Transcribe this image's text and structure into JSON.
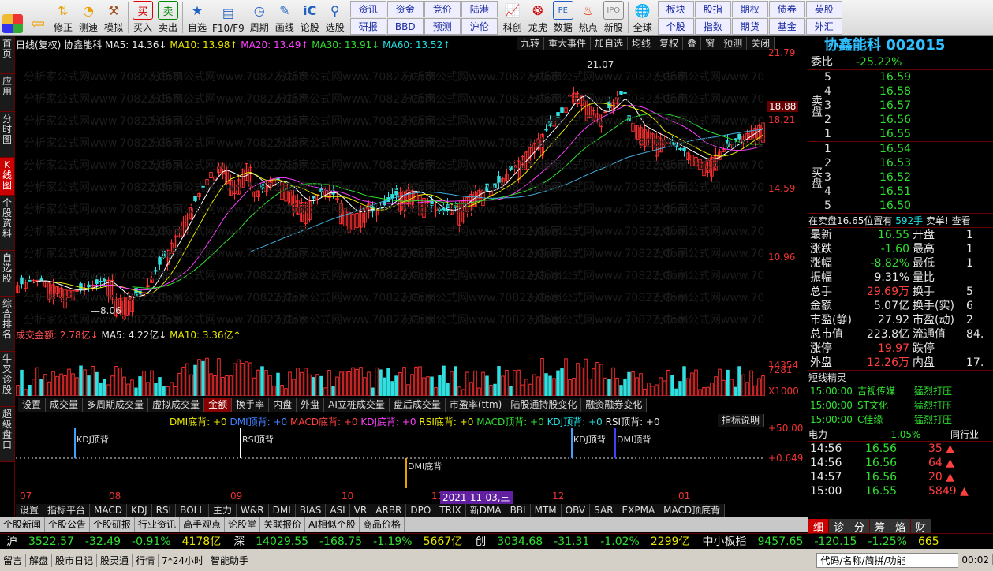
{
  "toolbar": {
    "items": [
      {
        "label": "修正",
        "icon": "arrow-left-icon"
      },
      {
        "label": "测速",
        "icon": "clock-icon"
      },
      {
        "label": "模拟",
        "icon": "hammer-icon"
      },
      {
        "label": "买入",
        "icon": "buy-icon"
      },
      {
        "label": "卖出",
        "icon": "sell-icon"
      },
      {
        "label": "自选",
        "icon": "star-icon"
      },
      {
        "label": "F10/F9",
        "icon": "f10-icon"
      },
      {
        "label": "周期",
        "icon": "period-icon"
      },
      {
        "label": "画线",
        "icon": "pencil-icon"
      },
      {
        "label": "论股",
        "icon": "chat-icon"
      },
      {
        "label": "选股",
        "icon": "magnify-icon"
      }
    ],
    "grid": [
      "资讯",
      "资金",
      "竞价",
      "陆港",
      "研报",
      "BBD",
      "预测",
      "沪伦"
    ],
    "right_items": [
      {
        "label": "科创",
        "icon": "chart-icon"
      },
      {
        "label": "龙虎",
        "icon": "dragon-icon"
      },
      {
        "label": "数据",
        "icon": "pe-icon"
      },
      {
        "label": "热点",
        "icon": "hot-icon"
      },
      {
        "label": "新股",
        "icon": "ipo-icon"
      },
      {
        "label": "全球",
        "icon": "globe-icon"
      }
    ],
    "grid2": [
      "板块",
      "股指",
      "期权",
      "债券",
      "英股",
      "个股",
      "指数",
      "期货",
      "基金",
      "外汇"
    ]
  },
  "left_tabs": [
    "首页",
    "应用",
    "分时图",
    "K线图",
    "个股资料",
    "自选股",
    "综合排名",
    "牛叉诊股",
    "超级盘口"
  ],
  "header": {
    "period": "日线(复权)",
    "name": "协鑫能科",
    "ma5": "MA5: 14.36↓",
    "ma10": "MA10: 13.98↑",
    "ma20": "MA20: 13.49↑",
    "ma30": "MA30: 13.91↓",
    "ma60": "MA60: 13.52↑",
    "buttons": [
      "九转",
      "重大事件",
      "加自选",
      "均线",
      "复权",
      "叠",
      "窗",
      "预测",
      "关闭"
    ]
  },
  "price_labels": [
    "21.79",
    "18.21",
    "14.59",
    "10.96"
  ],
  "current_price_tag": "18.88",
  "high_label": "21.07",
  "low_label": "8.06",
  "watermark": "分析家公式网www.70822.Com",
  "volume": {
    "label": "成交金额: 2.78亿↓",
    "ma5": "MA5: 4.22亿↓",
    "ma10": "MA10: 3.36亿↑",
    "ticks": [
      "14354",
      "7281",
      "X1000"
    ]
  },
  "sub_tabs": [
    "设置",
    "成交量",
    "多周期成交量",
    "虚拟成交量",
    "金额",
    "换手率",
    "内盘",
    "外盘",
    "AI立桩成交量",
    "盘后成交量",
    "市盈率(ttm)",
    "陆股通持股变化",
    "融资融券变化"
  ],
  "indicator": {
    "line": [
      {
        "t": "DMI底背: +0",
        "c": "yel"
      },
      {
        "t": "DMI顶背: +0",
        "c": "blu"
      },
      {
        "t": "MACD底背: +0",
        "c": "red"
      },
      {
        "t": "KDJ底背: +0",
        "c": "mag"
      },
      {
        "t": "RSI底背: +0",
        "c": "yel"
      },
      {
        "t": "MACD顶背: +0",
        "c": "green"
      },
      {
        "t": "KDJ顶背: +0",
        "c": "cyan"
      },
      {
        "t": "RSI顶背: +0",
        "c": "wht"
      }
    ],
    "explain": "指标说明",
    "ticks": [
      "+50.00",
      "+0.649"
    ],
    "marks": [
      "KDJ顶背",
      "RSI顶背",
      "DMI底背",
      "KDJ顶背",
      "DMI顶背"
    ]
  },
  "months": [
    "07",
    "08",
    "09",
    "10",
    "11",
    "12",
    "01"
  ],
  "date_label": "2021-11-03,三",
  "indicator_tabs": [
    "设置",
    "指标平台",
    "MACD",
    "KDJ",
    "RSI",
    "BOLL",
    "主力",
    "W&R",
    "DMI",
    "BIAS",
    "ASI",
    "VR",
    "ARBR",
    "DPO",
    "TRIX",
    "新DMA",
    "BBI",
    "MTM",
    "OBV",
    "SAR",
    "EXPMA",
    "MACD顶底背"
  ],
  "news_tabs": [
    "个股新闻",
    "个股公告",
    "个股研报",
    "行业资讯",
    "高手观点",
    "论股堂",
    "关联报价",
    "AI相似个股",
    "商品价格"
  ],
  "right": {
    "title": "协鑫能科 002015",
    "weibi_label": "委比",
    "weibi": "-25.22%",
    "sell": [
      {
        "n": "5",
        "p": "16.59"
      },
      {
        "n": "4",
        "p": "16.58"
      },
      {
        "n": "3",
        "p": "16.57"
      },
      {
        "n": "2",
        "p": "16.56"
      },
      {
        "n": "1",
        "p": "16.55"
      }
    ],
    "buy": [
      {
        "n": "1",
        "p": "16.54"
      },
      {
        "n": "2",
        "p": "16.53"
      },
      {
        "n": "3",
        "p": "16.52"
      },
      {
        "n": "4",
        "p": "16.51"
      },
      {
        "n": "5",
        "p": "16.50"
      }
    ],
    "sell_label": "卖盘",
    "buy_label": "买盘",
    "notice": "在卖盘16.65位置有",
    "notice_vol": "592手",
    "notice_tail": "卖单!",
    "notice_more": "查看",
    "stats": [
      [
        "最新",
        "16.55",
        "开盘",
        "1"
      ],
      [
        "涨跌",
        "-1.60",
        "最高",
        "1"
      ],
      [
        "涨幅",
        "-8.82%",
        "最低",
        "1"
      ],
      [
        "振幅",
        "9.31%",
        "量比",
        ""
      ],
      [
        "总手",
        "29.69万",
        "换手",
        "5"
      ],
      [
        "金额",
        "5.07亿",
        "换手(实)",
        "6"
      ],
      [
        "市盈(静)",
        "27.92",
        "市盈(动)",
        "2"
      ],
      [
        "总市值",
        "223.8亿",
        "流通值",
        "84."
      ],
      [
        "涨停",
        "19.97",
        "跌停",
        ""
      ],
      [
        "外盘",
        "12.26万",
        "内盘",
        "17."
      ]
    ],
    "short_title": "短线精灵",
    "short": [
      [
        "15:00:00",
        "吉视传媒",
        "猛烈打压"
      ],
      [
        "15:00:00",
        "ST文化",
        "猛烈打压"
      ],
      [
        "15:00:00",
        "C佳缘",
        "猛烈打压"
      ]
    ],
    "sector": "电力",
    "sector_chg": "-1.05%",
    "sector_btn": "同行业",
    "ticks": [
      [
        "14:56",
        "16.56",
        "35"
      ],
      [
        "14:56",
        "16.56",
        "64"
      ],
      [
        "14:57",
        "16.56",
        "20"
      ],
      [
        "15:00",
        "16.55",
        "5849"
      ]
    ],
    "bottom_tabs": [
      "细",
      "诊",
      "分",
      "筹",
      "焰",
      "财"
    ]
  },
  "index_bar": [
    {
      "name": "沪",
      "val": "3522.57",
      "chg": "-32.49",
      "pct": "-0.91%",
      "amt": "4178亿"
    },
    {
      "name": "深",
      "val": "14029.55",
      "chg": "-168.75",
      "pct": "-1.19%",
      "amt": "5667亿"
    },
    {
      "name": "创",
      "val": "3034.68",
      "chg": "-31.31",
      "pct": "-1.02%",
      "amt": "2299亿"
    },
    {
      "name": "中小板指",
      "val": "9457.65",
      "chg": "-120.15",
      "pct": "-1.25%",
      "amt": "665"
    }
  ],
  "status": {
    "items": [
      "留言",
      "解盘",
      "股市日记",
      "股灵通",
      "行情",
      "7*24小时",
      "智能助手"
    ],
    "search": "代码/名称/简拼/功能",
    "time": "00:02"
  },
  "colors": {
    "up": "#ff3030",
    "down": "#30e0e0",
    "ma5": "#ffffff",
    "ma10": "#e8e800",
    "ma20": "#ff40ff",
    "ma30": "#30e030",
    "ma60": "#40b0e0"
  }
}
